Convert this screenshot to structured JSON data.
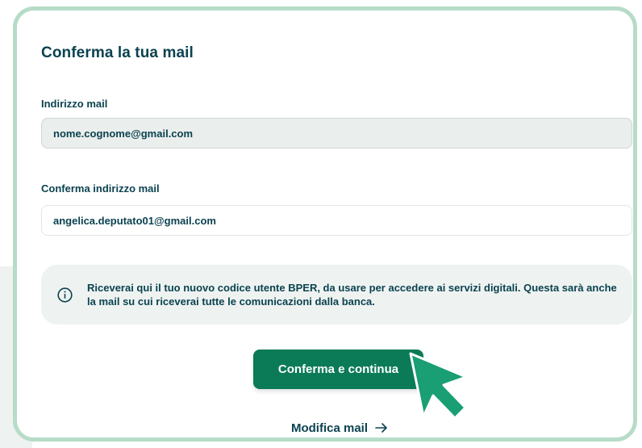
{
  "form": {
    "title": "Conferma la tua mail",
    "email_label": "Indirizzo mail",
    "email_value": "nome.cognome@gmail.com",
    "confirm_label": "Conferma indirizzo mail",
    "confirm_value": "angelica.deputato01@gmail.com"
  },
  "info": {
    "icon": "info-icon",
    "text": "Riceverai qui il tuo nuovo codice utente BPER, da usare per accedere ai servizi digitali. Questa sarà anche la mail su cui riceverai tutte le comunicazioni dalla banca."
  },
  "actions": {
    "confirm_button": "Conferma e continua",
    "edit_link": "Modifica mail",
    "edit_link_icon": "arrow-right-icon"
  },
  "colors": {
    "card_border": "#b6dcc8",
    "primary": "#0b7a57",
    "text": "#0b4250",
    "cursor": "#1a9e74"
  }
}
